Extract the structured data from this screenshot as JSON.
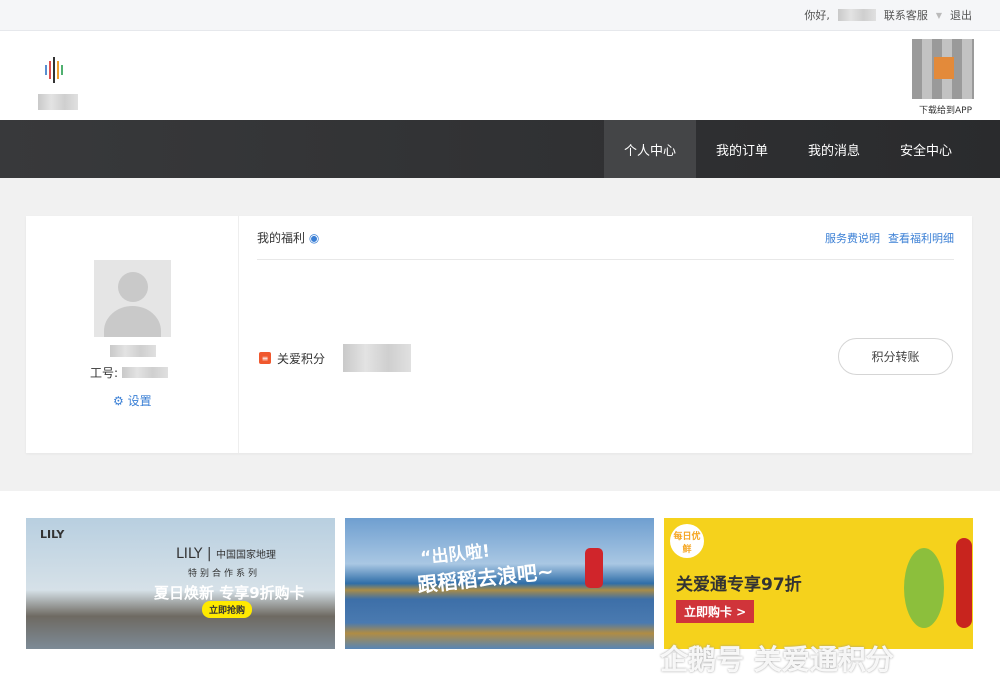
{
  "topbar": {
    "greeting": "你好,",
    "service": "联系客服",
    "logout": "退出"
  },
  "header": {
    "qr_label": "下载给到APP"
  },
  "nav": [
    {
      "label": "个人中心"
    },
    {
      "label": "我的订单"
    },
    {
      "label": "我的消息"
    },
    {
      "label": "安全中心"
    }
  ],
  "profile": {
    "emp_label": "工号:",
    "settings": "设置"
  },
  "benefits": {
    "title": "我的福利",
    "fee_link": "服务费说明",
    "detail_link": "查看福利明细",
    "points_label": "关爱积分",
    "transfer": "积分转账"
  },
  "banners": [
    {
      "brand": "LILY",
      "partner": "中国国家地理",
      "series": "特别合作系列",
      "headline": "夏日焕新 专享9折购卡",
      "cta": "立即抢购"
    },
    {
      "line1": "“出队啦!",
      "line2": "跟稻稻去浪吧~"
    },
    {
      "badge": "每日优鲜",
      "headline": "关爱通专享97折",
      "cta": "立即购卡 >"
    }
  ],
  "watermark": "企鹅号 关爱通积分"
}
